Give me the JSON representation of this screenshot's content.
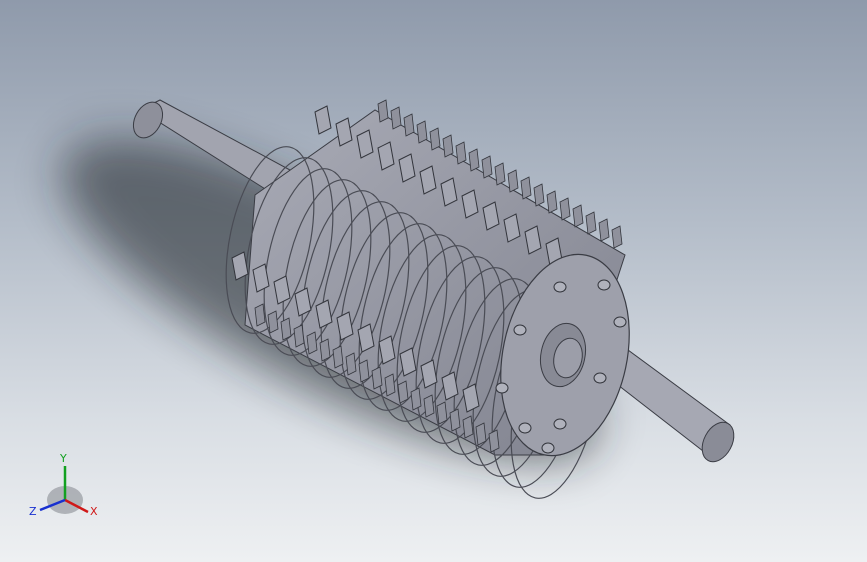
{
  "viewport": {
    "background_top": "#8f9aab",
    "background_bottom": "#eef0f2"
  },
  "model": {
    "icon": "crusher-rotor-shaft-assembly",
    "body_color": "#9a9ca8",
    "shadow_color": "#1e2226"
  },
  "triad": {
    "x_label": "X",
    "y_label": "Y",
    "z_label": "Z",
    "x_color": "#d01818",
    "y_color": "#12a020",
    "z_color": "#1830d0"
  }
}
